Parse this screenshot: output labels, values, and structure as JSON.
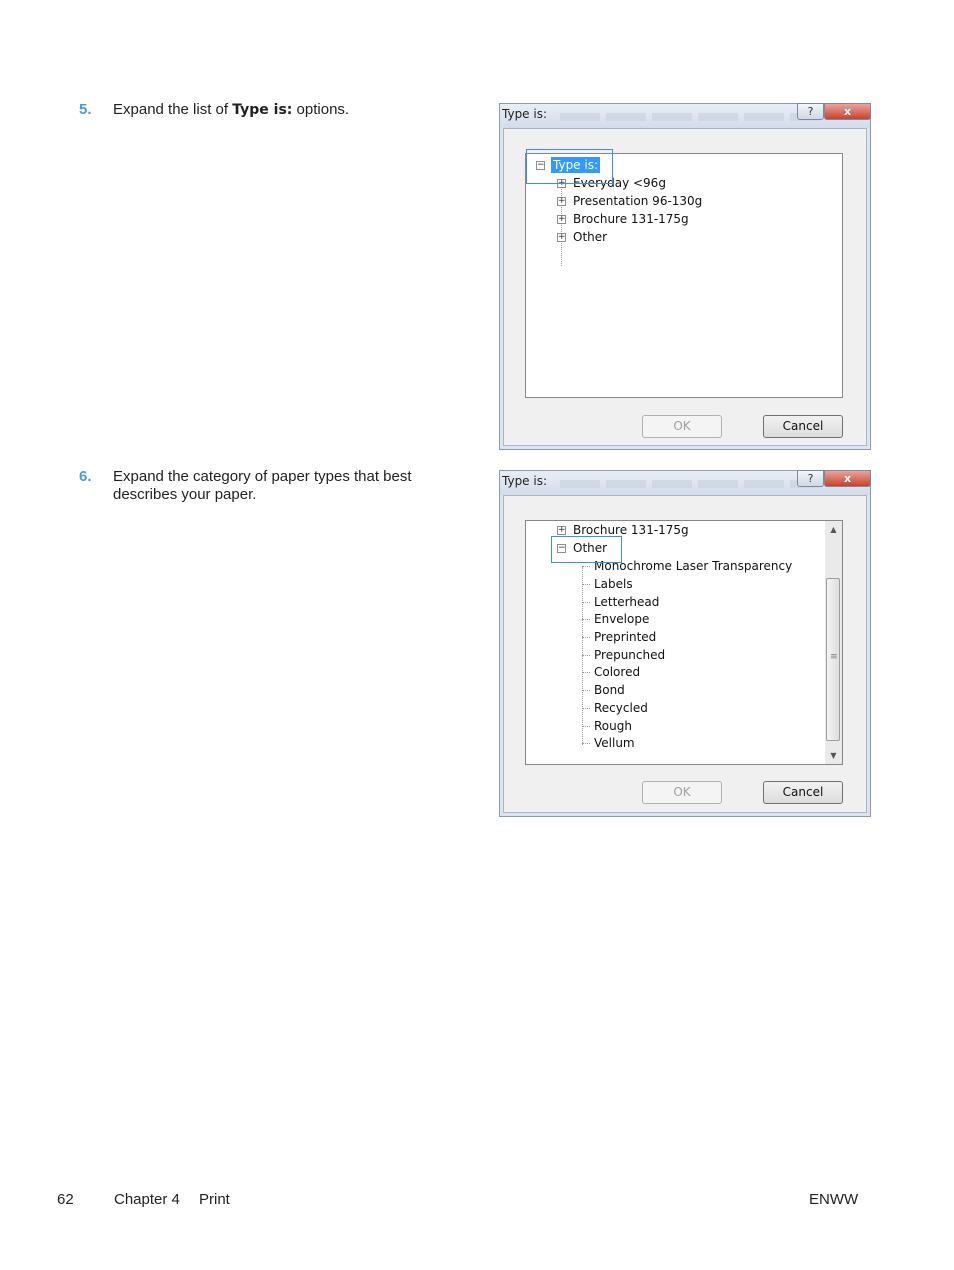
{
  "steps": [
    {
      "number": "5.",
      "text_before": "Expand the list of ",
      "text_bold": "Type is:",
      "text_after": " options."
    },
    {
      "number": "6.",
      "text": "Expand the category of paper types that best describes your paper."
    }
  ],
  "dialog1": {
    "title": "Type is:",
    "help_label": "?",
    "close_label": "x",
    "root_label": "Type is:",
    "items": [
      "Everyday <96g",
      "Presentation 96-130g",
      "Brochure 131-175g",
      "Other"
    ],
    "ok_label": "OK",
    "cancel_label": "Cancel"
  },
  "dialog2": {
    "title": "Type is:",
    "help_label": "?",
    "close_label": "x",
    "category_above": "Brochure 131-175g",
    "expanded_category": "Other",
    "subitems": [
      "Monochrome Laser Transparency",
      "Labels",
      "Letterhead",
      "Envelope",
      "Preprinted",
      "Prepunched",
      "Colored",
      "Bond",
      "Recycled",
      "Rough",
      "Vellum"
    ],
    "ok_label": "OK",
    "cancel_label": "Cancel"
  },
  "footer": {
    "page_number": "62",
    "chapter": "Chapter 4",
    "section": "Print",
    "doc_code": "ENWW"
  }
}
